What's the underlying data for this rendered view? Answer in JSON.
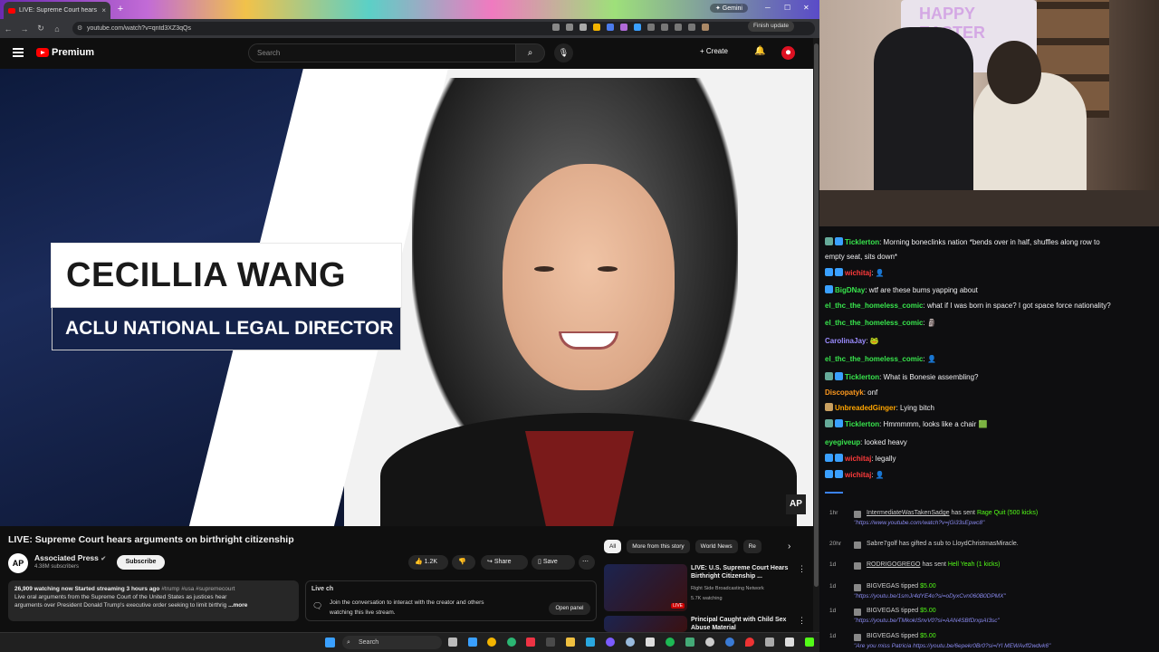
{
  "browser": {
    "tab_title": "LIVE: Supreme Court hears",
    "tab_close": "×",
    "new_tab": "+",
    "gemini": "✦ Gemini",
    "url": "youtube.com/watch?v=qntd3XZ3qQs",
    "finish_update": "Finish update"
  },
  "youtube": {
    "logo_text": "Premium",
    "search_placeholder": "Search",
    "create_label": "+ Create"
  },
  "video": {
    "lower_third_name": "CECILLIA WANG",
    "lower_third_title": "ACLU NATIONAL LEGAL DIRECTOR",
    "watermark": "AP"
  },
  "watch": {
    "title": "LIVE: Supreme Court hears arguments on birthright citizenship",
    "channel_avatar": "AP",
    "channel_name": "Associated Press",
    "channel_subs": "4.38M subscribers",
    "subscribe": "Subscribe",
    "likes": "1.2K",
    "share": "Share",
    "save": "Save",
    "desc_stats": "26,909 watching now  Started streaming 3 hours ago",
    "desc_tags": "#trump #usa #supremecourt",
    "desc_line1": "Live oral arguments from the Supreme Court of the United States as justices hear",
    "desc_line2": "arguments over President Donald Trump's executive order seeking to limit birthrig",
    "desc_more": "...more",
    "live_chat_label": "Live ch",
    "live_chat_line1": "Join the conversation to interact with the creator and others",
    "live_chat_line2": "watching this live stream.",
    "open_panel": "Open panel"
  },
  "recommendations": {
    "chips": [
      "All",
      "More from this story",
      "World News",
      "Re"
    ],
    "items": [
      {
        "title1": "LIVE: U.S. Supreme Court Hears",
        "title2": "Birthright Citizenship ...",
        "channel": "Right Side Broadcasting Network",
        "meta": "5.7K watching",
        "badge": "LIVE"
      },
      {
        "title1": "Principal Caught with Child Sex",
        "title2": "Abuse Material",
        "channel": "",
        "meta": "",
        "badge": ""
      }
    ]
  },
  "taskbar": {
    "search": "Search"
  },
  "stream": {
    "poster_text": "HAPPY EASTER"
  },
  "chat": {
    "messages": [
      {
        "user": "Ticklerton",
        "color": "#38e54d",
        "text": " Morning boneclinks nation  *bends over in half, shuffles along row to"
      },
      {
        "user": "",
        "color": "#efeff1",
        "text": "empty seat, sits down*"
      },
      {
        "user": "wichitaj",
        "color": "#ff3b3b",
        "text": " "
      },
      {
        "user": "BigDNay",
        "color": "#38e54d",
        "text": " wtf are these bums yapping about"
      },
      {
        "user": "el_thc_the_homeless_comic",
        "color": "#38e54d",
        "text": " what if I was born in space? I got space force nationality?"
      },
      {
        "user": "el_thc_the_homeless_comic",
        "color": "#38e54d",
        "text": " "
      },
      {
        "user": "CarolinaJay",
        "color": "#9b8cff",
        "text": " "
      },
      {
        "user": "el_thc_the_homeless_comic",
        "color": "#38e54d",
        "text": " "
      },
      {
        "user": "Ticklerton",
        "color": "#38e54d",
        "text": " What is Bonesie assembling?"
      },
      {
        "user": "Discopatyk",
        "color": "#ff9a1f",
        "text": " onf"
      },
      {
        "user": "UnbreadedGinger",
        "color": "#ffa500",
        "text": " Lying bitch"
      },
      {
        "user": "Ticklerton",
        "color": "#38e54d",
        "text": " Hmmmmm, looks like a chair"
      },
      {
        "user": "eyegiveup",
        "color": "#38e54d",
        "text": " looked heavy"
      },
      {
        "user": "wichitaj",
        "color": "#ff3b3b",
        "text": " legally"
      },
      {
        "user": "wichitaj",
        "color": "#ff3b3b",
        "text": " "
      }
    ],
    "events": [
      {
        "time": "1hr",
        "name": "IntermediateWasTakenSadge",
        "action": " has sent ",
        "gift": "Rage Quit (500 kicks)",
        "link": "\"https://www.youtube.com/watch?v=jGi33sEpwc8\""
      },
      {
        "time": "20hr",
        "name": "Sabre7golf",
        "action": " has gifted a sub to ",
        "gift": "LloydChristmasMiracle.",
        "link": ""
      },
      {
        "time": "1d",
        "name": "RODRIGOGREGO",
        "action": " has sent ",
        "gift": "Hell Yeah (1 kicks)",
        "link": ""
      },
      {
        "time": "1d",
        "name": "BIGVEGAS",
        "action": " tipped ",
        "gift": "$5.00",
        "link": "\"https://youtu.be/1smJr4dYE4o?si=oDyxCvn060B0DPMX\""
      },
      {
        "time": "1d",
        "name": "BIGVEGAS",
        "action": " tipped ",
        "gift": "$5.00",
        "link": "\"https://youtu.be/TMkokISnvV0?si=AAN4SBfDrxpAI3sc\""
      },
      {
        "time": "1d",
        "name": "BIGVEGAS",
        "action": " tipped ",
        "gift": "$5.00",
        "link": "\"Are you miss Patricia https://youtu.be/6epekr0Br0?si=lYl MEWAvff2wdvk6\""
      }
    ]
  }
}
